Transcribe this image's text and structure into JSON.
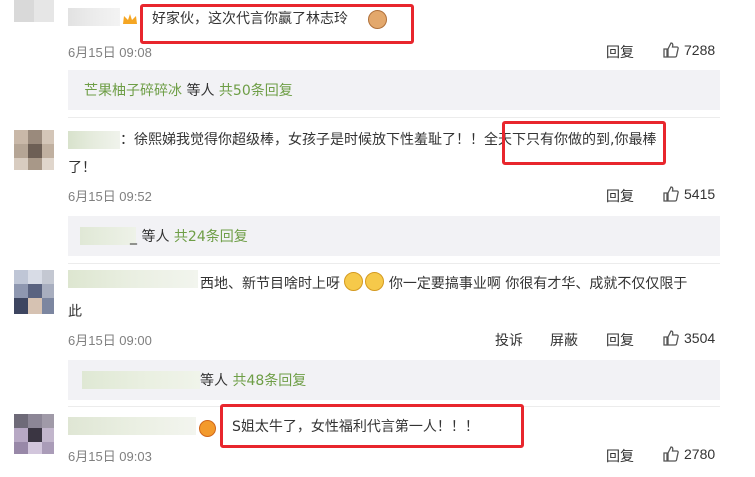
{
  "comments": [
    {
      "text": "好家伙，这次代言你赢了林志玲",
      "time": "6月15日 09:08",
      "reply_label": "回复",
      "likes": "7288"
    },
    {
      "text_prefix": "：徐熙娣我觉得你超级棒，女孩子是时候放下性羞耻了！！",
      "text_highlight": "全天下只有你做的到,",
      "text_suffix": "你最棒",
      "text_line2": "了！",
      "time": "6月15日 09:52",
      "reply_label": "回复",
      "likes": "5415"
    },
    {
      "text_line1": "西地、新节目啥时上呀",
      "text_line1b": "你一定要搞事业啊 你很有才华、成就不仅仅限于",
      "text_line2": "此",
      "time": "6月15日 09:00",
      "report_label": "投诉",
      "block_label": "屏蔽",
      "reply_label": "回复",
      "likes": "3504"
    },
    {
      "text": "S姐太牛了，女性福利代言第一人！！！",
      "time": "6月15日 09:03",
      "reply_label": "回复",
      "likes": "2780"
    }
  ],
  "reply_summaries": [
    {
      "name": "芒果柚子碎碎冰",
      "prefix": " 等人 ",
      "count": "共50条回复"
    },
    {
      "name": "_",
      "prefix": " 等人 ",
      "count": "共24条回复"
    },
    {
      "name": "",
      "prefix": "等人 ",
      "count": "共48条回复"
    }
  ],
  "colors": {
    "accent_green": "#6e9e46",
    "highlight_red": "#e8262d",
    "meta_gray": "#808080",
    "reply_bg": "#f2f2f5"
  },
  "icons": [
    "thumbs-up-icon",
    "crown-badge-icon",
    "monkey-emoji-icon",
    "crying-emoji-icon"
  ]
}
